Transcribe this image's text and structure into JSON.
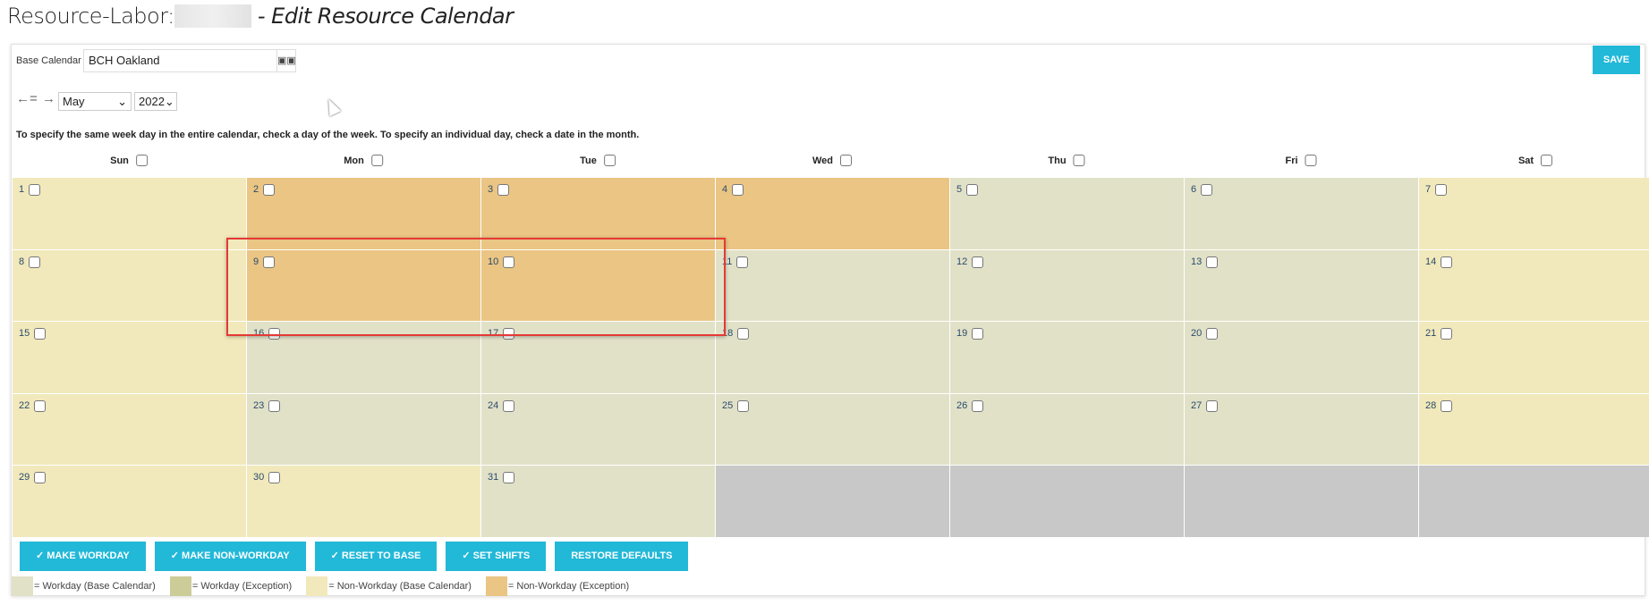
{
  "title": {
    "prefix": "Resource-Labor:",
    "suffix": "- Edit Resource Calendar"
  },
  "base_calendar": {
    "label": "Base Calendar",
    "value": "BCH Oakland",
    "lookup_icon": "binoculars-icon"
  },
  "save_label": "SAVE",
  "nav": {
    "prev": "←",
    "today": "=",
    "next": "→",
    "month": "May",
    "year": "2022"
  },
  "instruction": "To specify the same week day in the entire calendar, check a day of the week. To specify an individual day, check a date in the month.",
  "weekdays": [
    "Sun",
    "Mon",
    "Tue",
    "Wed",
    "Thu",
    "Fri",
    "Sat"
  ],
  "days": [
    {
      "d": "1",
      "s": "nb"
    },
    {
      "d": "2",
      "s": "ne"
    },
    {
      "d": "3",
      "s": "ne"
    },
    {
      "d": "4",
      "s": "ne"
    },
    {
      "d": "5",
      "s": "wb"
    },
    {
      "d": "6",
      "s": "wb"
    },
    {
      "d": "7",
      "s": "nb"
    },
    {
      "d": "8",
      "s": "nb"
    },
    {
      "d": "9",
      "s": "ne"
    },
    {
      "d": "10",
      "s": "ne"
    },
    {
      "d": "11",
      "s": "wb"
    },
    {
      "d": "12",
      "s": "wb"
    },
    {
      "d": "13",
      "s": "wb"
    },
    {
      "d": "14",
      "s": "nb"
    },
    {
      "d": "15",
      "s": "nb"
    },
    {
      "d": "16",
      "s": "wb"
    },
    {
      "d": "17",
      "s": "wb"
    },
    {
      "d": "18",
      "s": "wb"
    },
    {
      "d": "19",
      "s": "wb"
    },
    {
      "d": "20",
      "s": "wb"
    },
    {
      "d": "21",
      "s": "nb"
    },
    {
      "d": "22",
      "s": "nb"
    },
    {
      "d": "23",
      "s": "wb"
    },
    {
      "d": "24",
      "s": "wb"
    },
    {
      "d": "25",
      "s": "wb"
    },
    {
      "d": "26",
      "s": "wb"
    },
    {
      "d": "27",
      "s": "wb"
    },
    {
      "d": "28",
      "s": "nb"
    },
    {
      "d": "29",
      "s": "nb"
    },
    {
      "d": "30",
      "s": "nb"
    },
    {
      "d": "31",
      "s": "wb"
    },
    {
      "d": "",
      "s": "empty"
    },
    {
      "d": "",
      "s": "empty"
    },
    {
      "d": "",
      "s": "empty"
    },
    {
      "d": "",
      "s": "empty"
    }
  ],
  "actions": [
    "✓ MAKE WORKDAY",
    "✓ MAKE NON-WORKDAY",
    "✓ RESET TO BASE",
    "✓ SET SHIFTS",
    "RESTORE DEFAULTS"
  ],
  "legend": [
    {
      "label": "= Workday (Base Calendar)",
      "color": "#e1e1c8"
    },
    {
      "label": "= Workday (Exception)",
      "color": "#cccc99"
    },
    {
      "label": "= Non-Workday (Base Calendar)",
      "color": "#f1e9bb"
    },
    {
      "label": "= Non-Workday (Exception)",
      "color": "#eac583"
    }
  ],
  "colors": {
    "accent": "#22b8d8",
    "highlight": "#e53935",
    "empty": "#c8c8c8"
  }
}
